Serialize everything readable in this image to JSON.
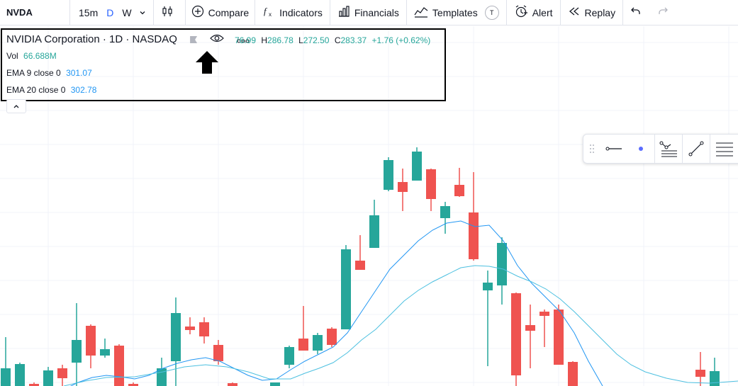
{
  "toolbar": {
    "symbol": "NVDA",
    "intervals": [
      "15m",
      "D",
      "W"
    ],
    "active_interval": "D",
    "compare_label": "Compare",
    "indicators_label": "Indicators",
    "financials_label": "Financials",
    "templates_label": "Templates",
    "templates_badge": "T",
    "alert_label": "Alert",
    "replay_label": "Replay"
  },
  "legend": {
    "title": "NVIDIA Corporation · 1D · NASDAQ",
    "ohlc_visible": "76.99",
    "high_label": "H",
    "high_value": "286.78",
    "low_label": "L",
    "low_value": "272.50",
    "close_label": "C",
    "close_value": "283.37",
    "change": "+1.76 (+0.62%)",
    "vol_label": "Vol",
    "vol_value": "66.688M",
    "ema9_label": "EMA 9 close 0",
    "ema9_value": "301.07",
    "ema20_label": "EMA 20 close 0",
    "ema20_value": "302.78"
  },
  "colors": {
    "up": "#26a69a",
    "down": "#ef5350",
    "ema9": "#2196f3",
    "ema20": "#4dc0e0",
    "accent": "#2962ff"
  },
  "floating_toolbar": {
    "icons": [
      "drag-handle-icon",
      "line-style-icon",
      "color-dot-icon",
      "path-settings-icon",
      "trend-line-icon",
      "more-settings-icon"
    ]
  }
}
